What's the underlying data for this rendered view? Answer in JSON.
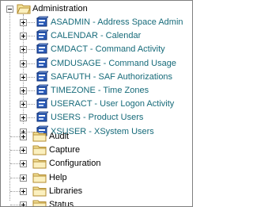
{
  "tree": {
    "root": {
      "label": "Administration",
      "icon": "folder-open-icon",
      "children": [
        {
          "label": "ASADMIN - Address Space Admin",
          "icon": "admin-node-icon"
        },
        {
          "label": "CALENDAR - Calendar",
          "icon": "admin-node-icon"
        },
        {
          "label": "CMDACT - Command Activity",
          "icon": "admin-node-icon"
        },
        {
          "label": "CMDUSAGE - Command Usage",
          "icon": "admin-node-icon"
        },
        {
          "label": "SAFAUTH - SAF Authorizations",
          "icon": "admin-node-icon"
        },
        {
          "label": "TIMEZONE - Time Zones",
          "icon": "admin-node-icon"
        },
        {
          "label": "USERACT - User Logon Activity",
          "icon": "admin-node-icon"
        },
        {
          "label": "USERS - Product Users",
          "icon": "admin-node-icon"
        },
        {
          "label": "XSUSER - XSystem Users",
          "icon": "admin-node-icon"
        }
      ]
    },
    "siblings": [
      {
        "label": "Audit",
        "icon": "folder-icon"
      },
      {
        "label": "Capture",
        "icon": "folder-icon"
      },
      {
        "label": "Configuration",
        "icon": "folder-icon"
      },
      {
        "label": "Help",
        "icon": "folder-icon"
      },
      {
        "label": "Libraries",
        "icon": "folder-icon"
      },
      {
        "label": "Status",
        "icon": "folder-icon"
      }
    ]
  },
  "colors": {
    "link_text": "#176b7a",
    "folder_fill": "#f6e59b",
    "folder_stroke": "#b38b2f",
    "node_icon_blue": "#2c5cb8"
  }
}
